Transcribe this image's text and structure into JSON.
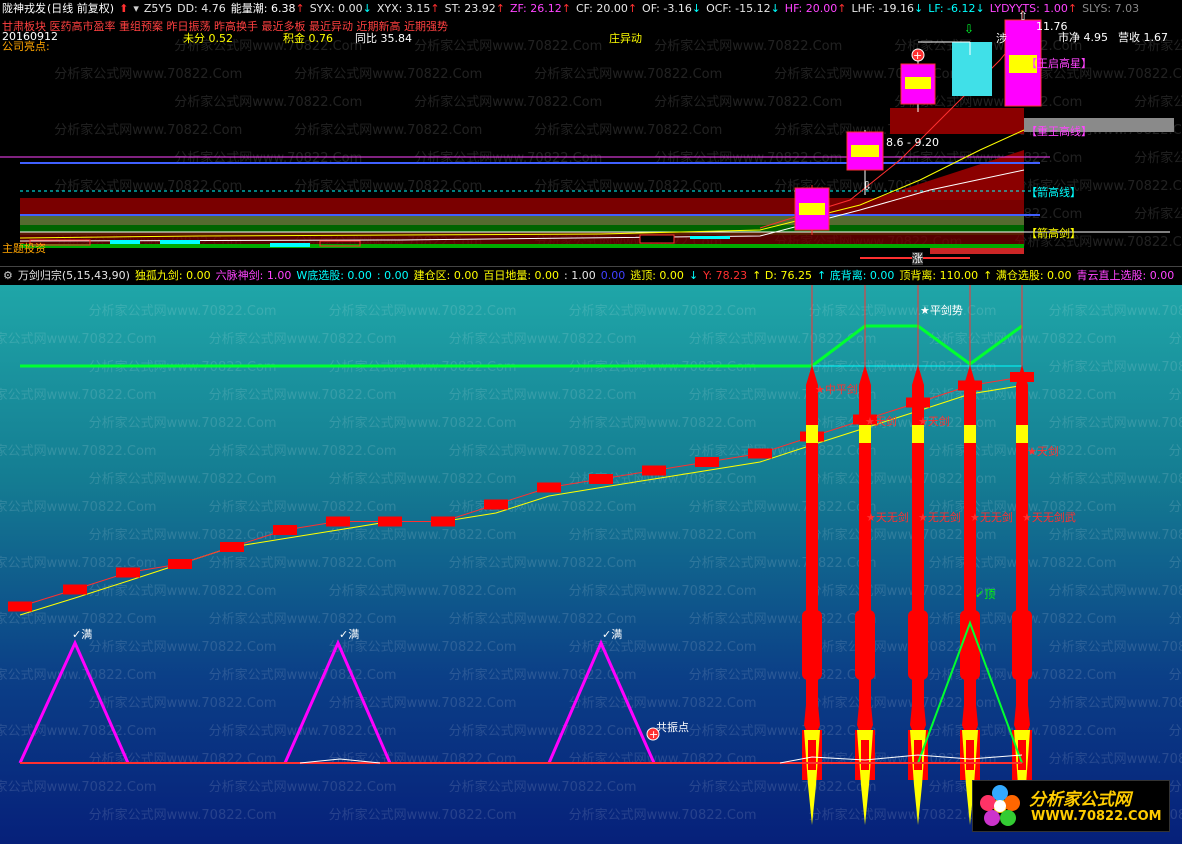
{
  "top_header": {
    "title": "陇神戎发",
    "period": "(日线 前复权)",
    "z": "Z5Y5",
    "stats": [
      {
        "label": "DD:",
        "value": "4.76",
        "color": "#e6e6e6",
        "arrow": ""
      },
      {
        "label": "能量潮:",
        "value": "6.38",
        "color": "#ffffff",
        "arrow": "↑",
        "arrow_color": "#ff3030"
      },
      {
        "label": "SYX:",
        "value": "0.00",
        "color": "#e6e6e6",
        "arrow": "↓",
        "arrow_color": "#00ffff"
      },
      {
        "label": "XYX:",
        "value": "3.15",
        "color": "#e6e6e6",
        "arrow": "↑",
        "arrow_color": "#ff3030"
      },
      {
        "label": "ST:",
        "value": "23.92",
        "color": "#e6e6e6",
        "arrow": "↑",
        "arrow_color": "#ff3030"
      },
      {
        "label": "ZF:",
        "value": "26.12",
        "color": "#ff44ff",
        "arrow": "↑",
        "arrow_color": "#ff3030"
      },
      {
        "label": "CF:",
        "value": "20.00",
        "color": "#e6e6e6",
        "arrow": "↑",
        "arrow_color": "#ff3030"
      },
      {
        "label": "OF:",
        "value": "-3.16",
        "color": "#e6e6e6",
        "arrow": "↓",
        "arrow_color": "#00ffff"
      },
      {
        "label": "OCF:",
        "value": "-15.12",
        "color": "#e6e6e6",
        "arrow": "↓",
        "arrow_color": "#00ffff"
      },
      {
        "label": "HF:",
        "value": "20.00",
        "color": "#ff44ff",
        "arrow": "↑",
        "arrow_color": "#ff3030"
      },
      {
        "label": "LHF:",
        "value": "-19.16",
        "color": "#e6e6e6",
        "arrow": "↓",
        "arrow_color": "#00ffff"
      },
      {
        "label": "LF:",
        "value": "-6.12",
        "color": "#00ffff",
        "arrow": "↓",
        "arrow_color": "#00ffff"
      },
      {
        "label": "LYDYYTS:",
        "value": "1.00",
        "color": "#ff44ff",
        "arrow": "↑",
        "arrow_color": "#ff3030"
      },
      {
        "label": "SLYS:",
        "value": "7.03",
        "color": "#888888",
        "arrow": "",
        "arrow_color": ""
      }
    ],
    "tags_line": "甘肃板块 医药高市盈率 重组预案 昨日振荡 昨高换手 最近多板 最近异动 近期新高 近期强势",
    "date": "20160912",
    "company": "公司亮点:",
    "weifen": "未分 0.52",
    "jijin": "积金 0.76",
    "tongbi": "同比 35.84",
    "zhuang": "庄异动",
    "shijing": "市净 4.95",
    "yingshou": "营收 1.67",
    "price_top": "11.76",
    "range_label": "8.6 - 9.20",
    "zhang": "涨",
    "main_label": "主题投资",
    "right_tags": [
      "【王启高星】",
      "【重王高线】",
      "【箭高线】",
      "【箭高剑】"
    ],
    "top_cut_label": "涉"
  },
  "sub_header": {
    "name": "万剑归宗(5,15,43,90)",
    "items": [
      {
        "label": "独孤九剑:",
        "value": "0.00",
        "color": "#ffff00"
      },
      {
        "label": "六脉神剑:",
        "value": "1.00",
        "color": "#ff44ff"
      },
      {
        "label": "W底选股:",
        "value": "0.00",
        "color": "#00ffff"
      },
      {
        "label": ":",
        "value": "0.00",
        "color": "#00ffff"
      },
      {
        "label": "建仓区:",
        "value": "0.00",
        "color": "#ffff00"
      },
      {
        "label": "百日地量:",
        "value": "0.00",
        "color": "#ffff00"
      },
      {
        "label": ":",
        "value": "1.00",
        "color": "#e6e6e6"
      },
      {
        "label": "",
        "value": "0.00",
        "color": "#4040ff"
      },
      {
        "label": "逃顶:",
        "value": "0.00",
        "color": "#ffff00"
      },
      {
        "label": "",
        "value": "↓",
        "color": "#00ffff"
      },
      {
        "label": "Y:",
        "value": "78.23",
        "color": "#ff3030"
      },
      {
        "label": "↑ D:",
        "value": "76.25",
        "color": "#ffff00"
      },
      {
        "label": "↑ 底背离:",
        "value": "0.00",
        "color": "#00ffff"
      },
      {
        "label": "顶背离:",
        "value": "110.00",
        "color": "#ffff00"
      },
      {
        "label": "↑ 满仓选股:",
        "value": "0.00",
        "color": "#ffff00"
      },
      {
        "label": "青云直上选股:",
        "value": "0.00",
        "color": "#ff44ff"
      }
    ]
  },
  "chart_data": {
    "type": "line",
    "title": "万剑归宗(5,15,43,90)",
    "series": [
      {
        "name": "red_blocks",
        "values": [
          48,
          50,
          52,
          53,
          55,
          57,
          58,
          58,
          58,
          60,
          62,
          63,
          64,
          65,
          66,
          68,
          70,
          72,
          74,
          75
        ]
      },
      {
        "name": "yellow_line",
        "values": [
          47,
          49,
          51,
          53,
          55,
          56,
          57,
          58,
          58,
          59,
          61,
          62,
          63,
          64,
          65,
          67,
          69,
          71,
          73,
          74
        ]
      }
    ],
    "annotations": [
      {
        "text": "✓满",
        "color": "#ffffff"
      },
      {
        "text": "✓满",
        "color": "#ffffff"
      },
      {
        "text": "✓满",
        "color": "#ffffff"
      },
      {
        "text": "共振点",
        "color": "#ffffff"
      },
      {
        "text": "★平剑势",
        "color": "#ffffff"
      },
      {
        "text": "✓顶",
        "color": "#00ff00"
      },
      {
        "text": "★中平剑",
        "color": "#ff3030"
      },
      {
        "text": "★天剑",
        "color": "#ff3030"
      },
      {
        "text": "★天剑",
        "color": "#ff3030"
      },
      {
        "text": "★天剑",
        "color": "#ff3030"
      },
      {
        "text": "★天无剑",
        "color": "#ff3030"
      },
      {
        "text": "★无无剑",
        "color": "#ff3030"
      },
      {
        "text": "★无无剑",
        "color": "#ff3030"
      },
      {
        "text": "★天无剑武",
        "color": "#ff3030"
      }
    ]
  },
  "watermark": "分析家公式网www.70822.Com",
  "logo": {
    "title": "分析家公式网",
    "url": "WWW.70822.COM"
  },
  "colors": {
    "up": "#ff3030",
    "down": "#00ffff",
    "magenta": "#ff00ff",
    "green": "#00ff30",
    "yellow": "#ffff00"
  }
}
